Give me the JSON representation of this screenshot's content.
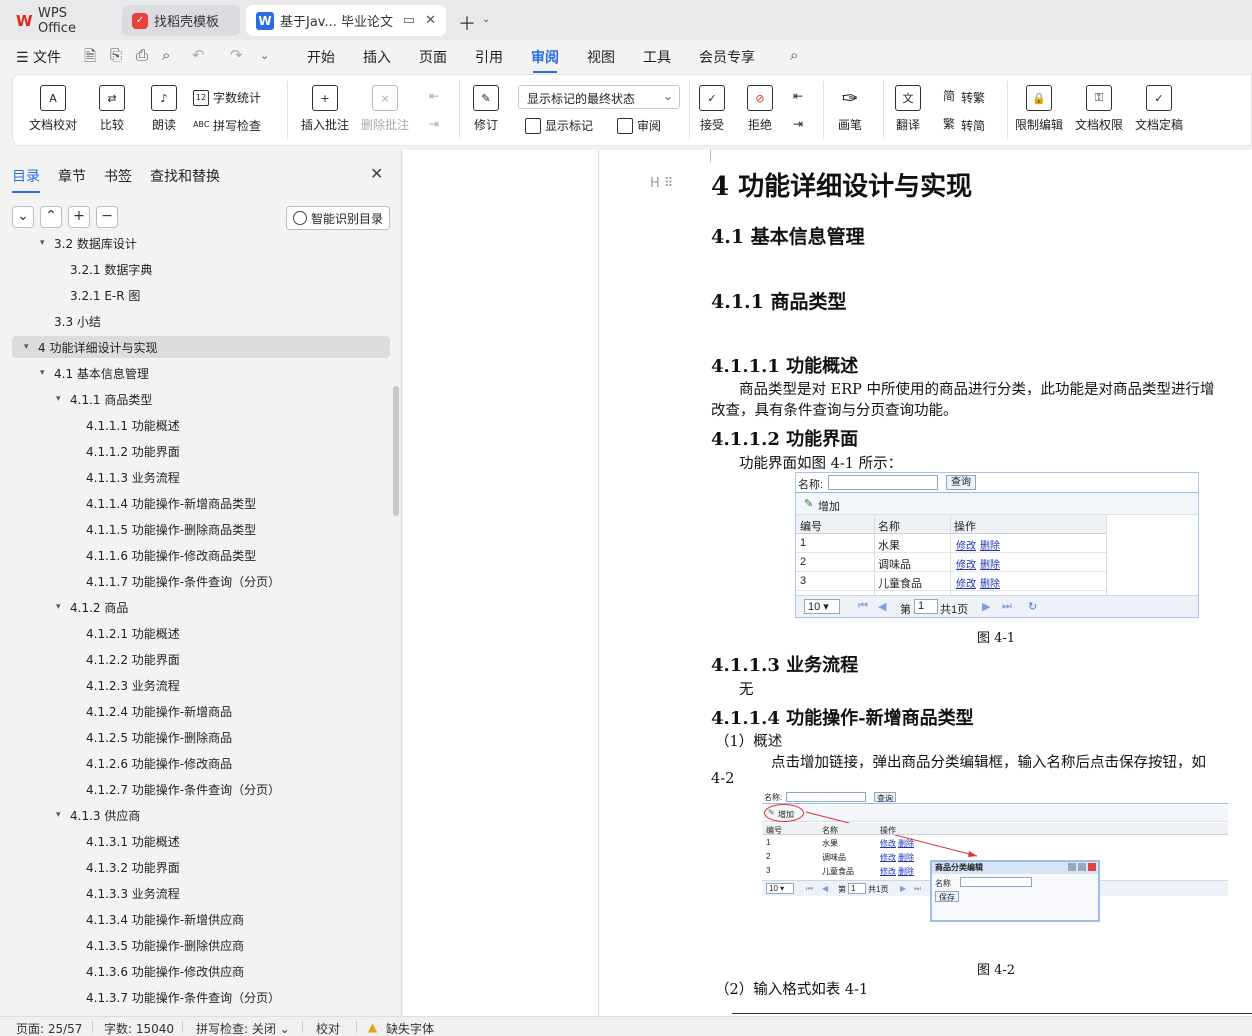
{
  "tabs": [
    {
      "label": "WPS Office"
    },
    {
      "label": "找稻壳模板"
    },
    {
      "label": "基于Jav... 毕业论文"
    }
  ],
  "menu": {
    "file": "文件",
    "items": [
      "开始",
      "插入",
      "页面",
      "引用",
      "审阅",
      "视图",
      "工具",
      "会员专享"
    ],
    "active": "审阅"
  },
  "ribbon": {
    "doc_check": "文档校对",
    "compare": "比较",
    "read_aloud": "朗读",
    "word_count": "字数统计",
    "spell_check": "拼写检查",
    "insert_comment": "插入批注",
    "delete_comment": "删除批注",
    "revise": "修订",
    "markup_state": "显示标记的最终状态",
    "show_markup": "显示标记",
    "review": "审阅",
    "accept": "接受",
    "reject": "拒绝",
    "pen": "画笔",
    "translate": "翻译",
    "to_traditional": "转繁",
    "to_simplified": "转简",
    "restrict_edit": "限制编辑",
    "doc_permission": "文档权限",
    "finalize": "文档定稿"
  },
  "sidepanel": {
    "tabs": [
      "目录",
      "章节",
      "书签",
      "查找和替换"
    ],
    "smart_toc": "智能识别目录",
    "toc": [
      {
        "label": "3.2 数据库设计",
        "level": 1,
        "arrow": "▾"
      },
      {
        "label": "3.2.1 数据字典",
        "level": 2,
        "arrow": ""
      },
      {
        "label": "3.2.1 E-R 图",
        "level": 2,
        "arrow": ""
      },
      {
        "label": "3.3  小结",
        "level": 1,
        "arrow": ""
      },
      {
        "label": "4  功能详细设计与实现",
        "level": 0,
        "arrow": "▾",
        "selected": true
      },
      {
        "label": "4.1 基本信息管理",
        "level": 1,
        "arrow": "▾"
      },
      {
        "label": "4.1.1 商品类型",
        "level": 2,
        "arrow": "▾"
      },
      {
        "label": "4.1.1.1 功能概述",
        "level": 3,
        "arrow": ""
      },
      {
        "label": "4.1.1.2 功能界面",
        "level": 3,
        "arrow": ""
      },
      {
        "label": "4.1.1.3 业务流程",
        "level": 3,
        "arrow": ""
      },
      {
        "label": "4.1.1.4 功能操作-新增商品类型",
        "level": 3,
        "arrow": ""
      },
      {
        "label": "4.1.1.5 功能操作-删除商品类型",
        "level": 3,
        "arrow": ""
      },
      {
        "label": "4.1.1.6 功能操作-修改商品类型",
        "level": 3,
        "arrow": ""
      },
      {
        "label": "4.1.1.7 功能操作-条件查询（分页）",
        "level": 3,
        "arrow": ""
      },
      {
        "label": "4.1.2 商品",
        "level": 2,
        "arrow": "▾"
      },
      {
        "label": "4.1.2.1 功能概述",
        "level": 3,
        "arrow": ""
      },
      {
        "label": "4.1.2.2 功能界面",
        "level": 3,
        "arrow": ""
      },
      {
        "label": "4.1.2.3 业务流程",
        "level": 3,
        "arrow": ""
      },
      {
        "label": "4.1.2.4 功能操作-新增商品",
        "level": 3,
        "arrow": ""
      },
      {
        "label": "4.1.2.5 功能操作-删除商品",
        "level": 3,
        "arrow": ""
      },
      {
        "label": "4.1.2.6 功能操作-修改商品",
        "level": 3,
        "arrow": ""
      },
      {
        "label": "4.1.2.7 功能操作-条件查询（分页）",
        "level": 3,
        "arrow": ""
      },
      {
        "label": "4.1.3 供应商",
        "level": 2,
        "arrow": "▾"
      },
      {
        "label": "4.1.3.1 功能概述",
        "level": 3,
        "arrow": ""
      },
      {
        "label": "4.1.3.2 功能界面",
        "level": 3,
        "arrow": ""
      },
      {
        "label": "4.1.3.3 业务流程",
        "level": 3,
        "arrow": ""
      },
      {
        "label": "4.1.3.4 功能操作-新增供应商",
        "level": 3,
        "arrow": ""
      },
      {
        "label": "4.1.3.5 功能操作-删除供应商",
        "level": 3,
        "arrow": ""
      },
      {
        "label": "4.1.3.6 功能操作-修改供应商",
        "level": 3,
        "arrow": ""
      },
      {
        "label": "4.1.3.7 功能操作-条件查询（分页）",
        "level": 3,
        "arrow": ""
      }
    ]
  },
  "document": {
    "h_chapter": "4  功能详细设计与实现",
    "h_41": "4.1 基本信息管理",
    "h_411": "4.1.1 商品类型",
    "h_4111": "4.1.1.1 功能概述",
    "p_4111_line1": "商品类型是对 ERP 中所使用的商品进行分类，此功能是对商品类型进行增",
    "p_4111_line2": "改查，具有条件查询与分页查询功能。",
    "h_4112": "4.1.1.2 功能界面",
    "p_4112": "功能界面如图 4-1 所示：",
    "fig1": {
      "name_label": "名称:",
      "query": "查询",
      "add": "增加",
      "headers": [
        "编号",
        "名称",
        "操作"
      ],
      "rows": [
        {
          "id": "1",
          "name": "水果",
          "edit": "修改",
          "del": "删除"
        },
        {
          "id": "2",
          "name": "调味品",
          "edit": "修改",
          "del": "删除"
        },
        {
          "id": "3",
          "name": "儿童食品",
          "edit": "修改",
          "del": "删除"
        }
      ],
      "page_size": "10",
      "page_prefix": "第",
      "page_num": "1",
      "page_total": "共1页",
      "caption": "图 4-1"
    },
    "h_4113": "4.1.1.3 业务流程",
    "p_4113": "无",
    "h_4114": "4.1.1.4 功能操作-新增商品类型",
    "p_overview": "（1）概述",
    "p_4114_line1": "点击增加链接，弹出商品分类编辑框，输入名称后点击保存按钮，如",
    "p_4114_line2": "4-2",
    "fig2": {
      "name_label": "名称:",
      "query": "查询",
      "add": "增加",
      "headers": [
        "编号",
        "名称",
        "操作"
      ],
      "rows": [
        {
          "id": "1",
          "name": "水果",
          "edit": "修改",
          "del": "删除"
        },
        {
          "id": "2",
          "name": "调味品",
          "edit": "修改",
          "del": "删除"
        },
        {
          "id": "3",
          "name": "儿童食品",
          "edit": "修改",
          "del": "删除"
        }
      ],
      "page_size": "10",
      "page_prefix": "第",
      "page_num": "1",
      "page_total": "共1页",
      "dialog_title": "商品分类编辑",
      "dialog_name": "名称",
      "dialog_save": "保存",
      "caption": "图 4-2"
    },
    "p_input_format": "（2）输入格式如表 4-1"
  },
  "status": {
    "page": "页面: 25/57",
    "words": "字数: 15040",
    "spell": "拼写检查: 关闭",
    "proof": "校对",
    "missing_font": "缺失字体"
  }
}
